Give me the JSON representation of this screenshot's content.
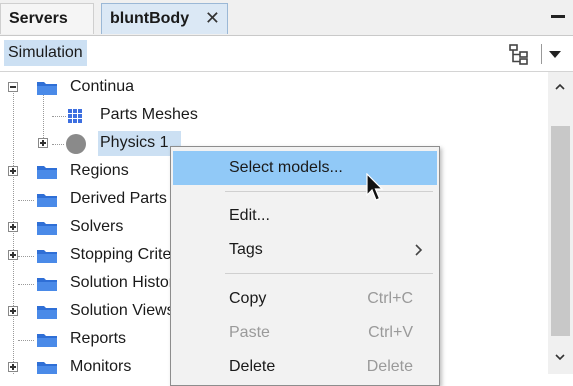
{
  "tabs": [
    {
      "label": "Servers",
      "active": false
    },
    {
      "label": "bluntBody",
      "active": true,
      "close_glyph": "✕"
    }
  ],
  "toolbar": {
    "simulation_label": "Simulation",
    "icons": [
      "tree-view-icon",
      "dropdown-arrow-icon"
    ]
  },
  "tree": [
    {
      "label": "Continua",
      "icon": "folder-icon",
      "expander": "minus",
      "level": 0
    },
    {
      "label": "Parts Meshes",
      "icon": "mesh-icon",
      "level": 1
    },
    {
      "label": "Physics 1",
      "icon": "physics-continuum-icon",
      "expander": "plus",
      "level": 1,
      "selected": true
    },
    {
      "label": "Regions",
      "icon": "folder-icon",
      "expander": "plus",
      "level": 0
    },
    {
      "label": "Derived Parts",
      "icon": "folder-icon",
      "level": 0
    },
    {
      "label": "Solvers",
      "icon": "folder-icon",
      "expander": "plus",
      "level": 0
    },
    {
      "label": "Stopping Criteria",
      "icon": "folder-icon",
      "expander": "plus",
      "level": 0
    },
    {
      "label": "Solution Histories",
      "icon": "folder-icon",
      "level": 0
    },
    {
      "label": "Solution Views",
      "icon": "folder-icon",
      "expander": "plus",
      "level": 0
    },
    {
      "label": "Reports",
      "icon": "folder-icon",
      "level": 0
    },
    {
      "label": "Monitors",
      "icon": "folder-icon",
      "expander": "plus",
      "level": 0
    }
  ],
  "context_menu": {
    "items": [
      {
        "label": "Select models...",
        "shortcut": "",
        "highlighted": true,
        "enabled": true
      },
      {
        "label": "Edit...",
        "shortcut": "",
        "enabled": true
      },
      {
        "label": "Tags",
        "shortcut": "",
        "submenu": true,
        "enabled": true
      },
      {
        "label": "Copy",
        "shortcut": "Ctrl+C",
        "enabled": true
      },
      {
        "label": "Paste",
        "shortcut": "Ctrl+V",
        "enabled": false
      },
      {
        "label": "Delete",
        "shortcut": "Delete",
        "enabled": true
      }
    ]
  },
  "colors": {
    "selection": "#cce0f3",
    "menu_highlight": "#91c9f7",
    "folder": "#2f6fd6",
    "mesh_icon": "#3d6fe0"
  }
}
